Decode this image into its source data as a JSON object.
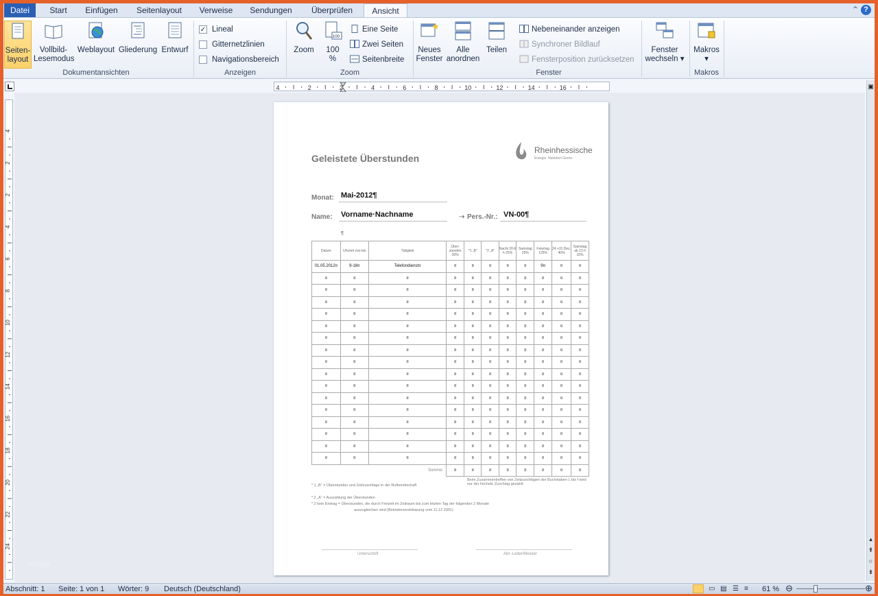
{
  "tabs": {
    "file": "Datei",
    "start": "Start",
    "insert": "Einfügen",
    "layout": "Seitenlayout",
    "refs": "Verweise",
    "mail": "Sendungen",
    "review": "Überprüfen",
    "view": "Ansicht"
  },
  "ribbon": {
    "views": {
      "print_layout": "Seiten-\nlayout",
      "print_l1": "Seiten-",
      "print_l2": "layout",
      "fullscreen_l1": "Vollbild-",
      "fullscreen_l2": "Lesemodus",
      "web": "Weblayout",
      "outline": "Gliederung",
      "draft": "Entwurf",
      "group": "Dokumentansichten"
    },
    "show": {
      "ruler": "Lineal",
      "ruler_checked": true,
      "grid": "Gitternetzlinien",
      "grid_checked": false,
      "nav": "Navigationsbereich",
      "nav_checked": false,
      "group": "Anzeigen"
    },
    "zoom": {
      "zoom": "Zoom",
      "hundred_l1": "100",
      "hundred_l2": "%",
      "one_page": "Eine Seite",
      "two_pages": "Zwei Seiten",
      "page_width": "Seitenbreite",
      "group": "Zoom"
    },
    "window": {
      "new_l1": "Neues",
      "new_l2": "Fenster",
      "arrange_l1": "Alle",
      "arrange_l2": "anordnen",
      "split": "Teilen",
      "side": "Nebeneinander anzeigen",
      "sync": "Synchroner Bildlauf",
      "reset": "Fensterposition zurücksetzen",
      "switch_l1": "Fenster",
      "switch_l2": "wechseln",
      "group": "Fenster"
    },
    "macros": {
      "label": "Makros",
      "group": "Makros"
    }
  },
  "ruler_labels": [
    "4",
    "2",
    "2",
    "4",
    "6",
    "8",
    "10",
    "12",
    "14",
    "16"
  ],
  "vruler_labels": [
    "4",
    "2",
    "2",
    "4",
    "6",
    "8",
    "10",
    "12",
    "14",
    "16",
    "18",
    "20",
    "22",
    "24"
  ],
  "document": {
    "title": "Geleistete Überstunden",
    "logo_name": "Rheinhessische",
    "logo_tagline": "Energie. Natürlich Gerne.",
    "month_label": "Monat:",
    "month_value": "Mai-2012¶",
    "name_label": "Name:",
    "name_value": "Vorname·Nachname",
    "pers_label": "Pers.-Nr.:",
    "pers_value": "VN-00¶",
    "pilcrow": "¶",
    "table_headers": [
      "Datum",
      "Uhrzeit von-bis",
      "Tätigkeit",
      "Über-stunden 30%",
      "*1 „B“",
      "*2 „A“",
      "Nacht 20-6 h 25%",
      "Samstag 25%",
      "Feiertag 125%",
      "24.+31.Dez. 40%",
      "Samstag ab 13 h 15%"
    ],
    "hdr_sub1": "*1",
    "hdr_sub2": "*2",
    "first_row": [
      "01.05.2012¤",
      "9-18¤",
      "Telefondienst¤",
      "¤",
      "¤",
      "¤",
      "¤",
      "¤",
      "9¤",
      "¤",
      "¤"
    ],
    "cell_mark": "¤",
    "sum_label": "Summe:",
    "note_right": "Beim Zusammentreffen von Zeitzuschlägen der Buchstaben L bis f wird nur der höchste Zuschlag gezahlt.",
    "note1": "* 1    „B“ = Überstunden und Zeitzuschläge in der Rufbereitschaft",
    "note2": "* 2    „A“ = Auszahlung der Überstunden",
    "note3": "* 2    kein Eintrag = Überstunden, die durch Freizeit im Zeitraum bis zum letzten Tag der folgenden 2 Monate",
    "note4": "auszugleichen sind  (Betriebsvereinbarung vom 11.12.2001)",
    "sig_left": "Unterschrift",
    "sig_right": "Abt.-Leiter/Meister"
  },
  "status": {
    "section": "Abschnitt: 1",
    "page": "Seite: 1 von 1",
    "words": "Wörter: 9",
    "lang": "Deutsch (Deutschland)",
    "zoom": "61 %"
  },
  "watermark": "vorlage"
}
